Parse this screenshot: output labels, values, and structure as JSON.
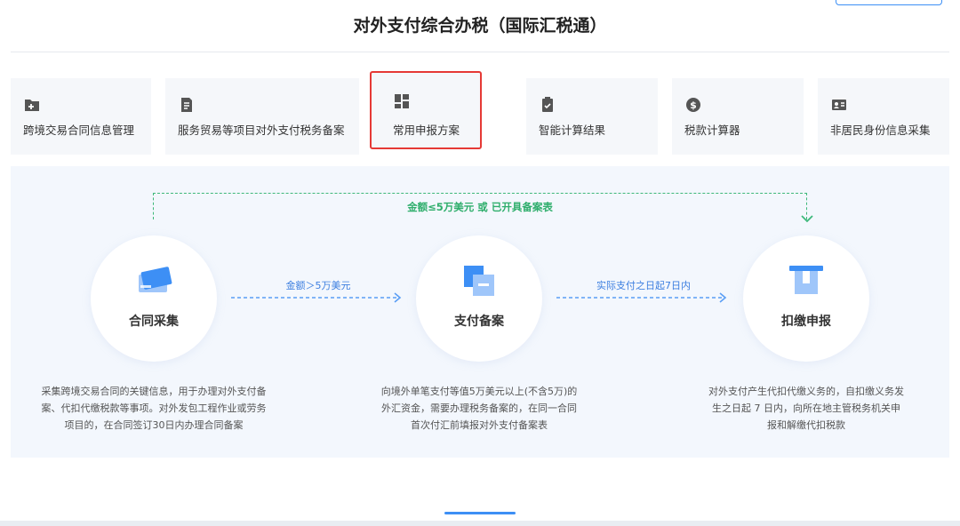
{
  "title": "对外支付综合办税（国际汇税通）",
  "cards": [
    {
      "label": "跨境交易合同信息管理",
      "icon": "folder-add-icon"
    },
    {
      "label": "服务贸易等项目对外支付税务备案",
      "icon": "document-icon"
    },
    {
      "label": "常用申报方案",
      "icon": "grid-icon"
    },
    {
      "label": "智能计算结果",
      "icon": "clipboard-icon"
    },
    {
      "label": "税款计算器",
      "icon": "dollar-coin-icon"
    },
    {
      "label": "非居民身份信息采集",
      "icon": "id-card-icon"
    }
  ],
  "flow": {
    "top_condition": "金额≤5万美元 或 已开具备案表",
    "steps": [
      {
        "label": "合同采集",
        "icon": "card-stack-icon"
      },
      {
        "label": "支付备案",
        "icon": "document-stack-icon"
      },
      {
        "label": "扣缴申报",
        "icon": "receipt-icon"
      }
    ],
    "arrow_conditions": [
      "金额＞5万美元",
      "实际支付之日起7日内"
    ],
    "descriptions": [
      [
        "采集跨境交易合同的关键信息，用于办理对外支付备",
        "案、代扣代缴税款等事项。对外发包工程作业或劳务",
        "项目的，在合同签订30日内办理合同备案"
      ],
      [
        "向境外单笔支付等值5万美元以上(不含5万)的",
        "外汇资金，需要办理税务备案的，在同一合同",
        "首次付汇前填报对外支付备案表"
      ],
      [
        "对外支付产生代扣代缴义务的，自扣缴义务发",
        "生之日起 7 日内，向所在地主管税务机关申",
        "报和解缴代扣税款"
      ]
    ]
  },
  "colors": {
    "primary": "#3d8ff5",
    "green": "#3db87a",
    "highlight": "#e53935"
  }
}
